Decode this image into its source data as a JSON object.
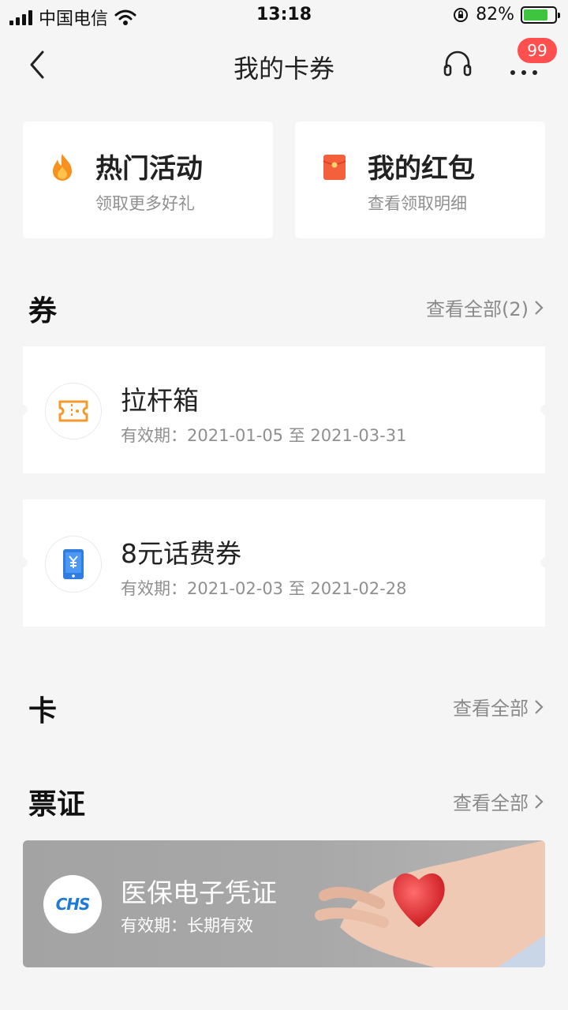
{
  "status_bar": {
    "carrier": "中国电信",
    "time": "13:18",
    "battery_percent": "82%"
  },
  "nav": {
    "title": "我的卡券",
    "badge_count": "99"
  },
  "quick_actions": [
    {
      "title": "热门活动",
      "subtitle": "领取更多好礼",
      "icon": "flame-icon",
      "color": "#f7901e"
    },
    {
      "title": "我的红包",
      "subtitle": "查看领取明细",
      "icon": "red-envelope-icon",
      "color": "#f4603c"
    }
  ],
  "sections": {
    "coupons": {
      "title": "券",
      "view_all": "查看全部(2)"
    },
    "cards": {
      "title": "卡",
      "view_all": "查看全部"
    },
    "tickets": {
      "title": "票证",
      "view_all": "查看全部"
    }
  },
  "coupons": [
    {
      "name": "拉杆箱",
      "validity": "有效期：2021-01-05 至 2021-03-31",
      "icon": "ticket-icon",
      "color": "#f39a2c"
    },
    {
      "name": "8元话费券",
      "validity": "有效期：2021-02-03 至 2021-02-28",
      "icon": "phone-yuan-icon",
      "color": "#2f7de1"
    }
  ],
  "voucher": {
    "logo_text": "CHS",
    "name": "医保电子凭证",
    "validity": "有效期：长期有效"
  }
}
